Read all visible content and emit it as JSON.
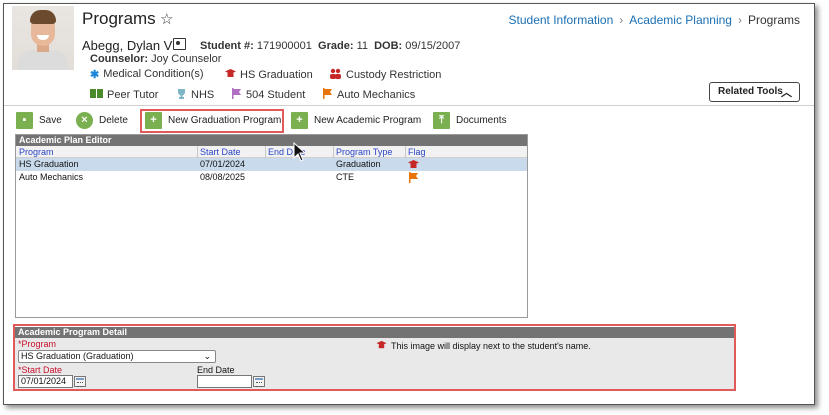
{
  "header": {
    "title": "Programs",
    "breadcrumb": [
      "Student Information",
      "Academic Planning",
      "Programs"
    ]
  },
  "student": {
    "name": "Abegg, Dylan V",
    "id_label": "Student #:",
    "id_value": "171900001",
    "grade_label": "Grade:",
    "grade_value": "11",
    "dob_label": "DOB:",
    "dob_value": "09/15/2007",
    "counselor_label": "Counselor:",
    "counselor_value": "Joy Counselor"
  },
  "flags": [
    {
      "label": "Medical Condition(s)",
      "icon": "asterisk-icon",
      "color": "#1e88d8"
    },
    {
      "label": "HS Graduation",
      "icon": "graduation-cap-icon",
      "color": "#c62828"
    },
    {
      "label": "Custody Restriction",
      "icon": "users-icon",
      "color": "#c62828"
    },
    {
      "label": "Peer Tutor",
      "icon": "book-icon",
      "color": "#4a8a2a"
    },
    {
      "label": "NHS",
      "icon": "trophy-icon",
      "color": "#7db6c7"
    },
    {
      "label": "504 Student",
      "icon": "flag-icon",
      "color": "#b06fc0"
    },
    {
      "label": "Auto Mechanics",
      "icon": "flag-icon",
      "color": "#e8740c"
    }
  ],
  "related_tools": {
    "label": "Related Tools"
  },
  "toolbar": {
    "save": "Save",
    "delete": "Delete",
    "new_graduation_program": "New Graduation Program",
    "new_academic_program": "New Academic Program",
    "documents": "Documents"
  },
  "editor": {
    "title": "Academic Plan Editor",
    "columns": [
      "Program",
      "Start Date",
      "End Date",
      "Program Type",
      "Flag"
    ],
    "rows": [
      {
        "program": "HS Graduation",
        "start": "07/01/2024",
        "end": "",
        "type": "Graduation",
        "flag_icon": "graduation-cap-icon",
        "flag_color": "#c62828"
      },
      {
        "program": "Auto Mechanics",
        "start": "08/08/2025",
        "end": "",
        "type": "CTE",
        "flag_icon": "flag-icon",
        "flag_color": "#e8740c"
      }
    ]
  },
  "detail": {
    "title": "Academic Program Detail",
    "program_label": "Program",
    "program_value": "HS Graduation (Graduation)",
    "start_label": "Start Date",
    "start_value": "07/01/2024",
    "end_label": "End Date",
    "end_value": "",
    "note": "This image will display next to the student's name."
  },
  "colors": {
    "link": "#1a6fb3",
    "button_green": "#7ab050",
    "highlight": "#e05a5a",
    "required": "#c8102e",
    "header_dark": "#737373",
    "selected_row": "#c8daeb"
  }
}
